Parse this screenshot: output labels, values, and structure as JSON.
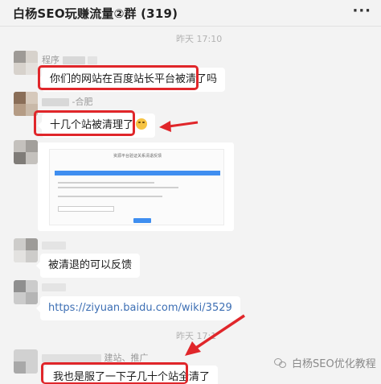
{
  "header": {
    "title": "白杨SEO玩赚流量②群 (319)",
    "more_label": "···"
  },
  "timestamps": {
    "first": "昨天 17:10",
    "second": "昨天 17:1"
  },
  "messages": [
    {
      "sender_visible": "程序",
      "text": "你们的网站在百度站长平台被清了吗"
    },
    {
      "sender_visible": "-合肥",
      "text": "十几个站被清理了"
    },
    {
      "sender_visible": "",
      "screenshot_title": "资源平台验证关系清退反馈"
    },
    {
      "sender_visible": "",
      "text": "被清退的可以反馈"
    },
    {
      "sender_visible": "",
      "text": "https://ziyuan.baidu.com/wiki/3529"
    },
    {
      "sender_visible": "建站、推广",
      "text": "我也是服了一下子几十个站全清了"
    }
  ],
  "watermark": {
    "text": "白杨SEO优化教程",
    "icon": "wechat-official-account-icon"
  },
  "colors": {
    "highlight": "#e0262a",
    "link": "#3d6fb4",
    "background": "#f3f3f3"
  }
}
